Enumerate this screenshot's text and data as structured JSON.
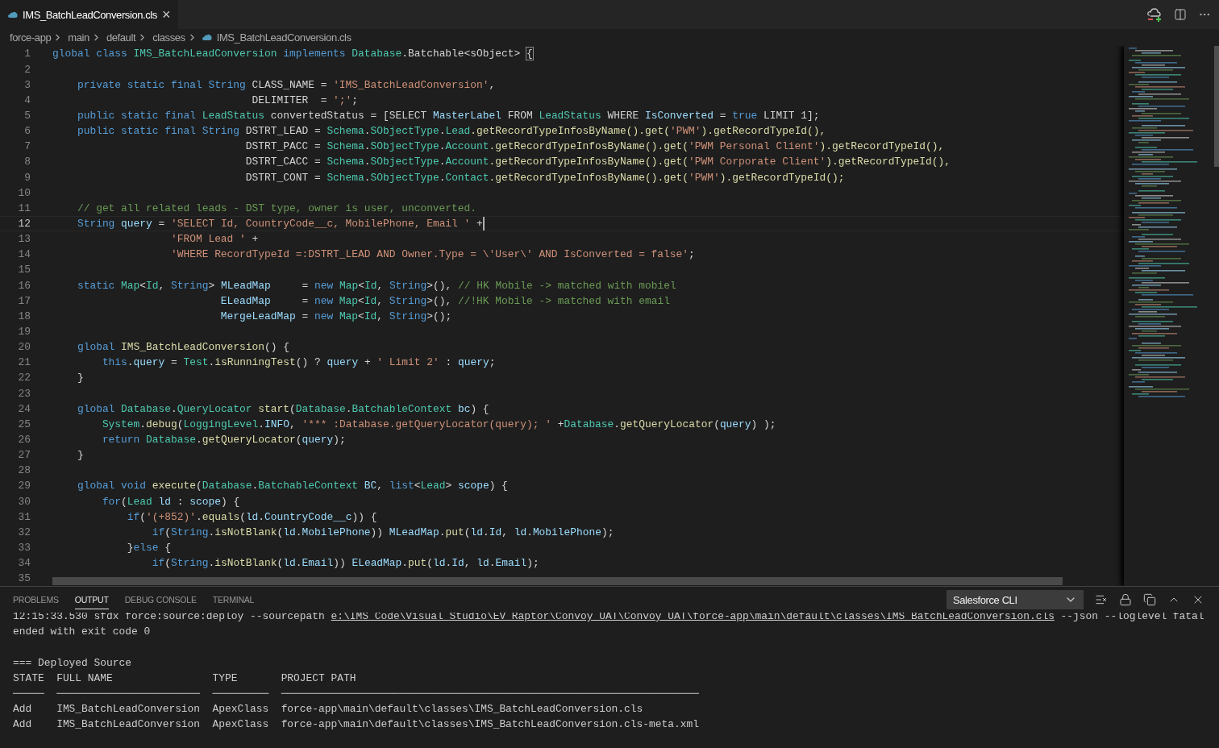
{
  "editor_tab": {
    "title": "IMS_BatchLeadConversion.cls",
    "close": "×",
    "selected": true
  },
  "breadcrumbs": [
    {
      "label": "force-app",
      "kind": "folder"
    },
    {
      "label": "main",
      "kind": "folder"
    },
    {
      "label": "default",
      "kind": "folder"
    },
    {
      "label": "classes",
      "kind": "folder"
    },
    {
      "label": "IMS_BatchLeadConversion.cls",
      "kind": "file"
    }
  ],
  "code_lines": [
    {
      "number": "1",
      "current": false,
      "tokens": [
        {
          "kind": "kw",
          "text": "global class "
        },
        {
          "kind": "type",
          "text": "IMS_BatchLeadConversion "
        },
        {
          "kind": "kw",
          "text": "implements "
        },
        {
          "kind": "type",
          "text": "Database"
        },
        {
          "kind": "plain",
          "text": ".Batchable<sObject> "
        },
        {
          "kind": "match",
          "text": "{"
        }
      ]
    },
    {
      "number": "2",
      "current": false
    },
    {
      "number": "3",
      "current": false,
      "tokens": [
        {
          "kind": "kw",
          "text": "    private static final String "
        },
        {
          "kind": "plain",
          "text": "CLASS_NAME = "
        },
        {
          "kind": "str",
          "text": "'IMS_BatchLeadConversion'"
        },
        {
          "kind": "plain",
          "text": ","
        }
      ]
    },
    {
      "number": "4",
      "current": false,
      "tokens": [
        {
          "kind": "plain",
          "text": "                                DELIMITER  = "
        },
        {
          "kind": "str",
          "text": "';'"
        },
        {
          "kind": "plain",
          "text": ";"
        }
      ]
    },
    {
      "number": "5",
      "current": false,
      "tokens": [
        {
          "kind": "kw",
          "text": "    public static final "
        },
        {
          "kind": "type",
          "text": "LeadStatus "
        },
        {
          "kind": "plain",
          "text": "convertedStatus = [SELECT "
        },
        {
          "kind": "var",
          "text": "MasterLabel"
        },
        {
          "kind": "plain",
          "text": " FROM "
        },
        {
          "kind": "type",
          "text": "LeadStatus"
        },
        {
          "kind": "plain",
          "text": " WHERE "
        },
        {
          "kind": "var",
          "text": "IsConverted"
        },
        {
          "kind": "plain",
          "text": " = "
        },
        {
          "kind": "kw",
          "text": "true"
        },
        {
          "kind": "plain",
          "text": " LIMIT 1];"
        }
      ]
    },
    {
      "number": "6",
      "current": false,
      "tokens": [
        {
          "kind": "kw",
          "text": "    public static final String "
        },
        {
          "kind": "plain",
          "text": "DSTRT_LEAD = "
        },
        {
          "kind": "type",
          "text": "Schema"
        },
        {
          "kind": "plain",
          "text": "."
        },
        {
          "kind": "type",
          "text": "SObjectType"
        },
        {
          "kind": "plain",
          "text": "."
        },
        {
          "kind": "type",
          "text": "Lead"
        },
        {
          "kind": "fn",
          "text": ".getRecordTypeInfosByName().get("
        },
        {
          "kind": "str",
          "text": "'PWM'"
        },
        {
          "kind": "fn",
          "text": ").getRecordTypeId(),"
        }
      ]
    },
    {
      "number": "7",
      "current": false,
      "tokens": [
        {
          "kind": "plain",
          "text": "                               DSTRT_PACC = "
        },
        {
          "kind": "type",
          "text": "Schema"
        },
        {
          "kind": "plain",
          "text": "."
        },
        {
          "kind": "type",
          "text": "SObjectType"
        },
        {
          "kind": "plain",
          "text": "."
        },
        {
          "kind": "type",
          "text": "Account"
        },
        {
          "kind": "fn",
          "text": ".getRecordTypeInfosByName().get("
        },
        {
          "kind": "str",
          "text": "'PWM Personal Client'"
        },
        {
          "kind": "fn",
          "text": ").getRecordTypeId(),"
        }
      ]
    },
    {
      "number": "8",
      "current": false,
      "tokens": [
        {
          "kind": "plain",
          "text": "                               DSTRT_CACC = "
        },
        {
          "kind": "type",
          "text": "Schema"
        },
        {
          "kind": "plain",
          "text": "."
        },
        {
          "kind": "type",
          "text": "SObjectType"
        },
        {
          "kind": "plain",
          "text": "."
        },
        {
          "kind": "type",
          "text": "Account"
        },
        {
          "kind": "fn",
          "text": ".getRecordTypeInfosByName().get("
        },
        {
          "kind": "str",
          "text": "'PWM Corporate Client'"
        },
        {
          "kind": "fn",
          "text": ").getRecordTypeId(),"
        }
      ]
    },
    {
      "number": "9",
      "current": false,
      "tokens": [
        {
          "kind": "plain",
          "text": "                               DSTRT_CONT = "
        },
        {
          "kind": "type",
          "text": "Schema"
        },
        {
          "kind": "plain",
          "text": "."
        },
        {
          "kind": "type",
          "text": "SObjectType"
        },
        {
          "kind": "plain",
          "text": "."
        },
        {
          "kind": "type",
          "text": "Contact"
        },
        {
          "kind": "fn",
          "text": ".getRecordTypeInfosByName().get("
        },
        {
          "kind": "str",
          "text": "'PWM'"
        },
        {
          "kind": "fn",
          "text": ").getRecordTypeId();"
        }
      ]
    },
    {
      "number": "10",
      "current": false
    },
    {
      "number": "11",
      "current": false,
      "tokens": [
        {
          "kind": "com",
          "text": "    // get all related leads - DST type, owner is user, unconverted."
        }
      ]
    },
    {
      "number": "12",
      "current": true,
      "tokens": [
        {
          "kind": "kw",
          "text": "    String "
        },
        {
          "kind": "var",
          "text": "query"
        },
        {
          "kind": "plain",
          "text": " = "
        },
        {
          "kind": "str",
          "text": "'SELECT Id, CountryCode__c, MobilePhone, Email '"
        },
        {
          "kind": "plain",
          "text": " +"
        }
      ]
    },
    {
      "number": "13",
      "current": false,
      "tokens": [
        {
          "kind": "str",
          "text": "                   'FROM Lead '"
        },
        {
          "kind": "plain",
          "text": " +"
        }
      ]
    },
    {
      "number": "14",
      "current": false,
      "tokens": [
        {
          "kind": "str",
          "text": "                   'WHERE RecordTypeId =:DSTRT_LEAD AND Owner.Type = \\'User\\' AND IsConverted = false'"
        },
        {
          "kind": "plain",
          "text": ";"
        }
      ]
    },
    {
      "number": "15",
      "current": false
    },
    {
      "number": "16",
      "current": false,
      "tokens": [
        {
          "kind": "kw",
          "text": "    static "
        },
        {
          "kind": "type",
          "text": "Map"
        },
        {
          "kind": "plain",
          "text": "<"
        },
        {
          "kind": "type",
          "text": "Id"
        },
        {
          "kind": "plain",
          "text": ", "
        },
        {
          "kind": "kw",
          "text": "String"
        },
        {
          "kind": "plain",
          "text": "> "
        },
        {
          "kind": "var",
          "text": "MLeadMap"
        },
        {
          "kind": "plain",
          "text": "     = "
        },
        {
          "kind": "kw",
          "text": "new "
        },
        {
          "kind": "type",
          "text": "Map"
        },
        {
          "kind": "plain",
          "text": "<"
        },
        {
          "kind": "type",
          "text": "Id"
        },
        {
          "kind": "plain",
          "text": ", "
        },
        {
          "kind": "kw",
          "text": "String"
        },
        {
          "kind": "plain",
          "text": ">(), "
        },
        {
          "kind": "com",
          "text": "// HK Mobile -> matched with mobiel"
        }
      ]
    },
    {
      "number": "17",
      "current": false,
      "tokens": [
        {
          "kind": "var",
          "text": "                           ELeadMap"
        },
        {
          "kind": "plain",
          "text": "     = "
        },
        {
          "kind": "kw",
          "text": "new "
        },
        {
          "kind": "type",
          "text": "Map"
        },
        {
          "kind": "plain",
          "text": "<"
        },
        {
          "kind": "type",
          "text": "Id"
        },
        {
          "kind": "plain",
          "text": ", "
        },
        {
          "kind": "kw",
          "text": "String"
        },
        {
          "kind": "plain",
          "text": ">(), "
        },
        {
          "kind": "com",
          "text": "//!HK Mobile -> matched with email"
        }
      ]
    },
    {
      "number": "18",
      "current": false,
      "tokens": [
        {
          "kind": "var",
          "text": "                           MergeLeadMap"
        },
        {
          "kind": "plain",
          "text": " = "
        },
        {
          "kind": "kw",
          "text": "new "
        },
        {
          "kind": "type",
          "text": "Map"
        },
        {
          "kind": "plain",
          "text": "<"
        },
        {
          "kind": "type",
          "text": "Id"
        },
        {
          "kind": "plain",
          "text": ", "
        },
        {
          "kind": "kw",
          "text": "String"
        },
        {
          "kind": "plain",
          "text": ">();"
        }
      ]
    },
    {
      "number": "19",
      "current": false
    },
    {
      "number": "20",
      "current": false,
      "tokens": [
        {
          "kind": "kw",
          "text": "    global "
        },
        {
          "kind": "fn",
          "text": "IMS_BatchLeadConversion"
        },
        {
          "kind": "plain",
          "text": "() {"
        }
      ]
    },
    {
      "number": "21",
      "current": false,
      "tokens": [
        {
          "kind": "kw",
          "text": "        this"
        },
        {
          "kind": "plain",
          "text": "."
        },
        {
          "kind": "var",
          "text": "query"
        },
        {
          "kind": "plain",
          "text": " = "
        },
        {
          "kind": "type",
          "text": "Test"
        },
        {
          "kind": "plain",
          "text": "."
        },
        {
          "kind": "fn",
          "text": "isRunningTest"
        },
        {
          "kind": "plain",
          "text": "() ? "
        },
        {
          "kind": "var",
          "text": "query"
        },
        {
          "kind": "plain",
          "text": " + "
        },
        {
          "kind": "str",
          "text": "' Limit 2'"
        },
        {
          "kind": "plain",
          "text": " : "
        },
        {
          "kind": "var",
          "text": "query"
        },
        {
          "kind": "plain",
          "text": ";"
        }
      ]
    },
    {
      "number": "22",
      "current": false,
      "tokens": [
        {
          "kind": "plain",
          "text": "    }"
        }
      ]
    },
    {
      "number": "23",
      "current": false
    },
    {
      "number": "24",
      "current": false,
      "tokens": [
        {
          "kind": "kw",
          "text": "    global "
        },
        {
          "kind": "type",
          "text": "Database"
        },
        {
          "kind": "plain",
          "text": "."
        },
        {
          "kind": "type",
          "text": "QueryLocator "
        },
        {
          "kind": "fn",
          "text": "start"
        },
        {
          "kind": "plain",
          "text": "("
        },
        {
          "kind": "type",
          "text": "Database"
        },
        {
          "kind": "plain",
          "text": "."
        },
        {
          "kind": "type",
          "text": "BatchableContext "
        },
        {
          "kind": "var",
          "text": "bc"
        },
        {
          "kind": "plain",
          "text": ") {"
        }
      ]
    },
    {
      "number": "25",
      "current": false,
      "tokens": [
        {
          "kind": "type",
          "text": "        System"
        },
        {
          "kind": "plain",
          "text": "."
        },
        {
          "kind": "fn",
          "text": "debug"
        },
        {
          "kind": "plain",
          "text": "("
        },
        {
          "kind": "type",
          "text": "LoggingLevel"
        },
        {
          "kind": "plain",
          "text": "."
        },
        {
          "kind": "var",
          "text": "INFO"
        },
        {
          "kind": "plain",
          "text": ", "
        },
        {
          "kind": "str",
          "text": "'*** :Database.getQueryLocator(query); '"
        },
        {
          "kind": "plain",
          "text": " +"
        },
        {
          "kind": "type",
          "text": "Database"
        },
        {
          "kind": "plain",
          "text": "."
        },
        {
          "kind": "fn",
          "text": "getQueryLocator"
        },
        {
          "kind": "plain",
          "text": "("
        },
        {
          "kind": "var",
          "text": "query"
        },
        {
          "kind": "plain",
          "text": ") );"
        }
      ]
    },
    {
      "number": "26",
      "current": false,
      "tokens": [
        {
          "kind": "kw",
          "text": "        return "
        },
        {
          "kind": "type",
          "text": "Database"
        },
        {
          "kind": "plain",
          "text": "."
        },
        {
          "kind": "fn",
          "text": "getQueryLocator"
        },
        {
          "kind": "plain",
          "text": "("
        },
        {
          "kind": "var",
          "text": "query"
        },
        {
          "kind": "plain",
          "text": ");"
        }
      ]
    },
    {
      "number": "27",
      "current": false,
      "tokens": [
        {
          "kind": "plain",
          "text": "    }"
        }
      ]
    },
    {
      "number": "28",
      "current": false
    },
    {
      "number": "29",
      "current": false,
      "tokens": [
        {
          "kind": "kw",
          "text": "    global void "
        },
        {
          "kind": "fn",
          "text": "execute"
        },
        {
          "kind": "plain",
          "text": "("
        },
        {
          "kind": "type",
          "text": "Database"
        },
        {
          "kind": "plain",
          "text": "."
        },
        {
          "kind": "type",
          "text": "BatchableContext "
        },
        {
          "kind": "var",
          "text": "BC"
        },
        {
          "kind": "plain",
          "text": ", "
        },
        {
          "kind": "kw",
          "text": "list"
        },
        {
          "kind": "plain",
          "text": "<"
        },
        {
          "kind": "type",
          "text": "Lead"
        },
        {
          "kind": "plain",
          "text": "> "
        },
        {
          "kind": "var",
          "text": "scope"
        },
        {
          "kind": "plain",
          "text": ") {"
        }
      ]
    },
    {
      "number": "30",
      "current": false,
      "tokens": [
        {
          "kind": "kw",
          "text": "        for"
        },
        {
          "kind": "plain",
          "text": "("
        },
        {
          "kind": "type",
          "text": "Lead "
        },
        {
          "kind": "var",
          "text": "ld"
        },
        {
          "kind": "plain",
          "text": " : "
        },
        {
          "kind": "var",
          "text": "scope"
        },
        {
          "kind": "plain",
          "text": ") {"
        }
      ]
    },
    {
      "number": "31",
      "current": false,
      "tokens": [
        {
          "kind": "kw",
          "text": "            if"
        },
        {
          "kind": "plain",
          "text": "("
        },
        {
          "kind": "str",
          "text": "'(+852)'"
        },
        {
          "kind": "plain",
          "text": "."
        },
        {
          "kind": "fn",
          "text": "equals"
        },
        {
          "kind": "plain",
          "text": "("
        },
        {
          "kind": "var",
          "text": "ld"
        },
        {
          "kind": "plain",
          "text": "."
        },
        {
          "kind": "var",
          "text": "CountryCode__c"
        },
        {
          "kind": "plain",
          "text": ")) {"
        }
      ]
    },
    {
      "number": "32",
      "current": false,
      "tokens": [
        {
          "kind": "kw",
          "text": "                if"
        },
        {
          "kind": "plain",
          "text": "("
        },
        {
          "kind": "kw",
          "text": "String"
        },
        {
          "kind": "plain",
          "text": "."
        },
        {
          "kind": "fn",
          "text": "isNotBlank"
        },
        {
          "kind": "plain",
          "text": "("
        },
        {
          "kind": "var",
          "text": "ld"
        },
        {
          "kind": "plain",
          "text": "."
        },
        {
          "kind": "var",
          "text": "MobilePhone"
        },
        {
          "kind": "plain",
          "text": ")) "
        },
        {
          "kind": "var",
          "text": "MLeadMap"
        },
        {
          "kind": "plain",
          "text": "."
        },
        {
          "kind": "fn",
          "text": "put"
        },
        {
          "kind": "plain",
          "text": "("
        },
        {
          "kind": "var",
          "text": "ld"
        },
        {
          "kind": "plain",
          "text": "."
        },
        {
          "kind": "var",
          "text": "Id"
        },
        {
          "kind": "plain",
          "text": ", "
        },
        {
          "kind": "var",
          "text": "ld"
        },
        {
          "kind": "plain",
          "text": "."
        },
        {
          "kind": "var",
          "text": "MobilePhone"
        },
        {
          "kind": "plain",
          "text": ");"
        }
      ]
    },
    {
      "number": "33",
      "current": false,
      "tokens": [
        {
          "kind": "plain",
          "text": "            }"
        },
        {
          "kind": "kw",
          "text": "else"
        },
        {
          "kind": "plain",
          "text": " {"
        }
      ]
    },
    {
      "number": "34",
      "current": false,
      "tokens": [
        {
          "kind": "kw",
          "text": "                if"
        },
        {
          "kind": "plain",
          "text": "("
        },
        {
          "kind": "kw",
          "text": "String"
        },
        {
          "kind": "plain",
          "text": "."
        },
        {
          "kind": "fn",
          "text": "isNotBlank"
        },
        {
          "kind": "plain",
          "text": "("
        },
        {
          "kind": "var",
          "text": "ld"
        },
        {
          "kind": "plain",
          "text": "."
        },
        {
          "kind": "var",
          "text": "Email"
        },
        {
          "kind": "plain",
          "text": ")) "
        },
        {
          "kind": "var",
          "text": "ELeadMap"
        },
        {
          "kind": "plain",
          "text": "."
        },
        {
          "kind": "fn",
          "text": "put"
        },
        {
          "kind": "plain",
          "text": "("
        },
        {
          "kind": "var",
          "text": "ld"
        },
        {
          "kind": "plain",
          "text": "."
        },
        {
          "kind": "var",
          "text": "Id"
        },
        {
          "kind": "plain",
          "text": ", "
        },
        {
          "kind": "var",
          "text": "ld"
        },
        {
          "kind": "plain",
          "text": "."
        },
        {
          "kind": "var",
          "text": "Email"
        },
        {
          "kind": "plain",
          "text": ");"
        }
      ]
    },
    {
      "number": "35",
      "current": false
    }
  ],
  "panel": {
    "tabs": [
      {
        "label": "PROBLEMS",
        "selected": false
      },
      {
        "label": "OUTPUT",
        "selected": true
      },
      {
        "label": "DEBUG CONSOLE",
        "selected": false
      },
      {
        "label": "TERMINAL",
        "selected": false
      }
    ],
    "channel": "Salesforce CLI",
    "output_lines": [
      {
        "kind": "text",
        "segments": [
          {
            "kind": "text",
            "text": "12:15:33.530 sfdx force:source:deploy --sourcepath "
          },
          {
            "kind": "link",
            "text": "e:\\IMS_Code\\Visual Studio\\EV_Raptor\\Convoy_UAT\\Convoy_UAT\\force-app\\main\\default\\classes\\IMS_BatchLeadConversion.cls"
          },
          {
            "kind": "text",
            "text": " --json --loglevel fatal"
          }
        ]
      },
      {
        "kind": "text",
        "segments": [
          {
            "kind": "text",
            "text": "ended with exit code 0"
          }
        ]
      },
      {
        "kind": "blank"
      },
      {
        "kind": "text",
        "segments": [
          {
            "kind": "text",
            "text": "=== Deployed Source"
          }
        ]
      },
      {
        "kind": "text",
        "segments": [
          {
            "kind": "text",
            "text": "STATE  FULL NAME                TYPE       PROJECT PATH"
          }
        ]
      },
      {
        "kind": "text",
        "segments": [
          {
            "kind": "text",
            "text": "─────  ───────────────────────  ─────────  ───────────────────────────────────────────────────────────────────"
          }
        ]
      },
      {
        "kind": "text",
        "segments": [
          {
            "kind": "text",
            "text": "Add    IMS_BatchLeadConversion  ApexClass  force-app\\main\\default\\classes\\IMS_BatchLeadConversion.cls"
          }
        ]
      },
      {
        "kind": "text",
        "segments": [
          {
            "kind": "text",
            "text": "Add    IMS_BatchLeadConversion  ApexClass  force-app\\main\\default\\classes\\IMS_BatchLeadConversion.cls-meta.xml"
          }
        ]
      }
    ]
  }
}
